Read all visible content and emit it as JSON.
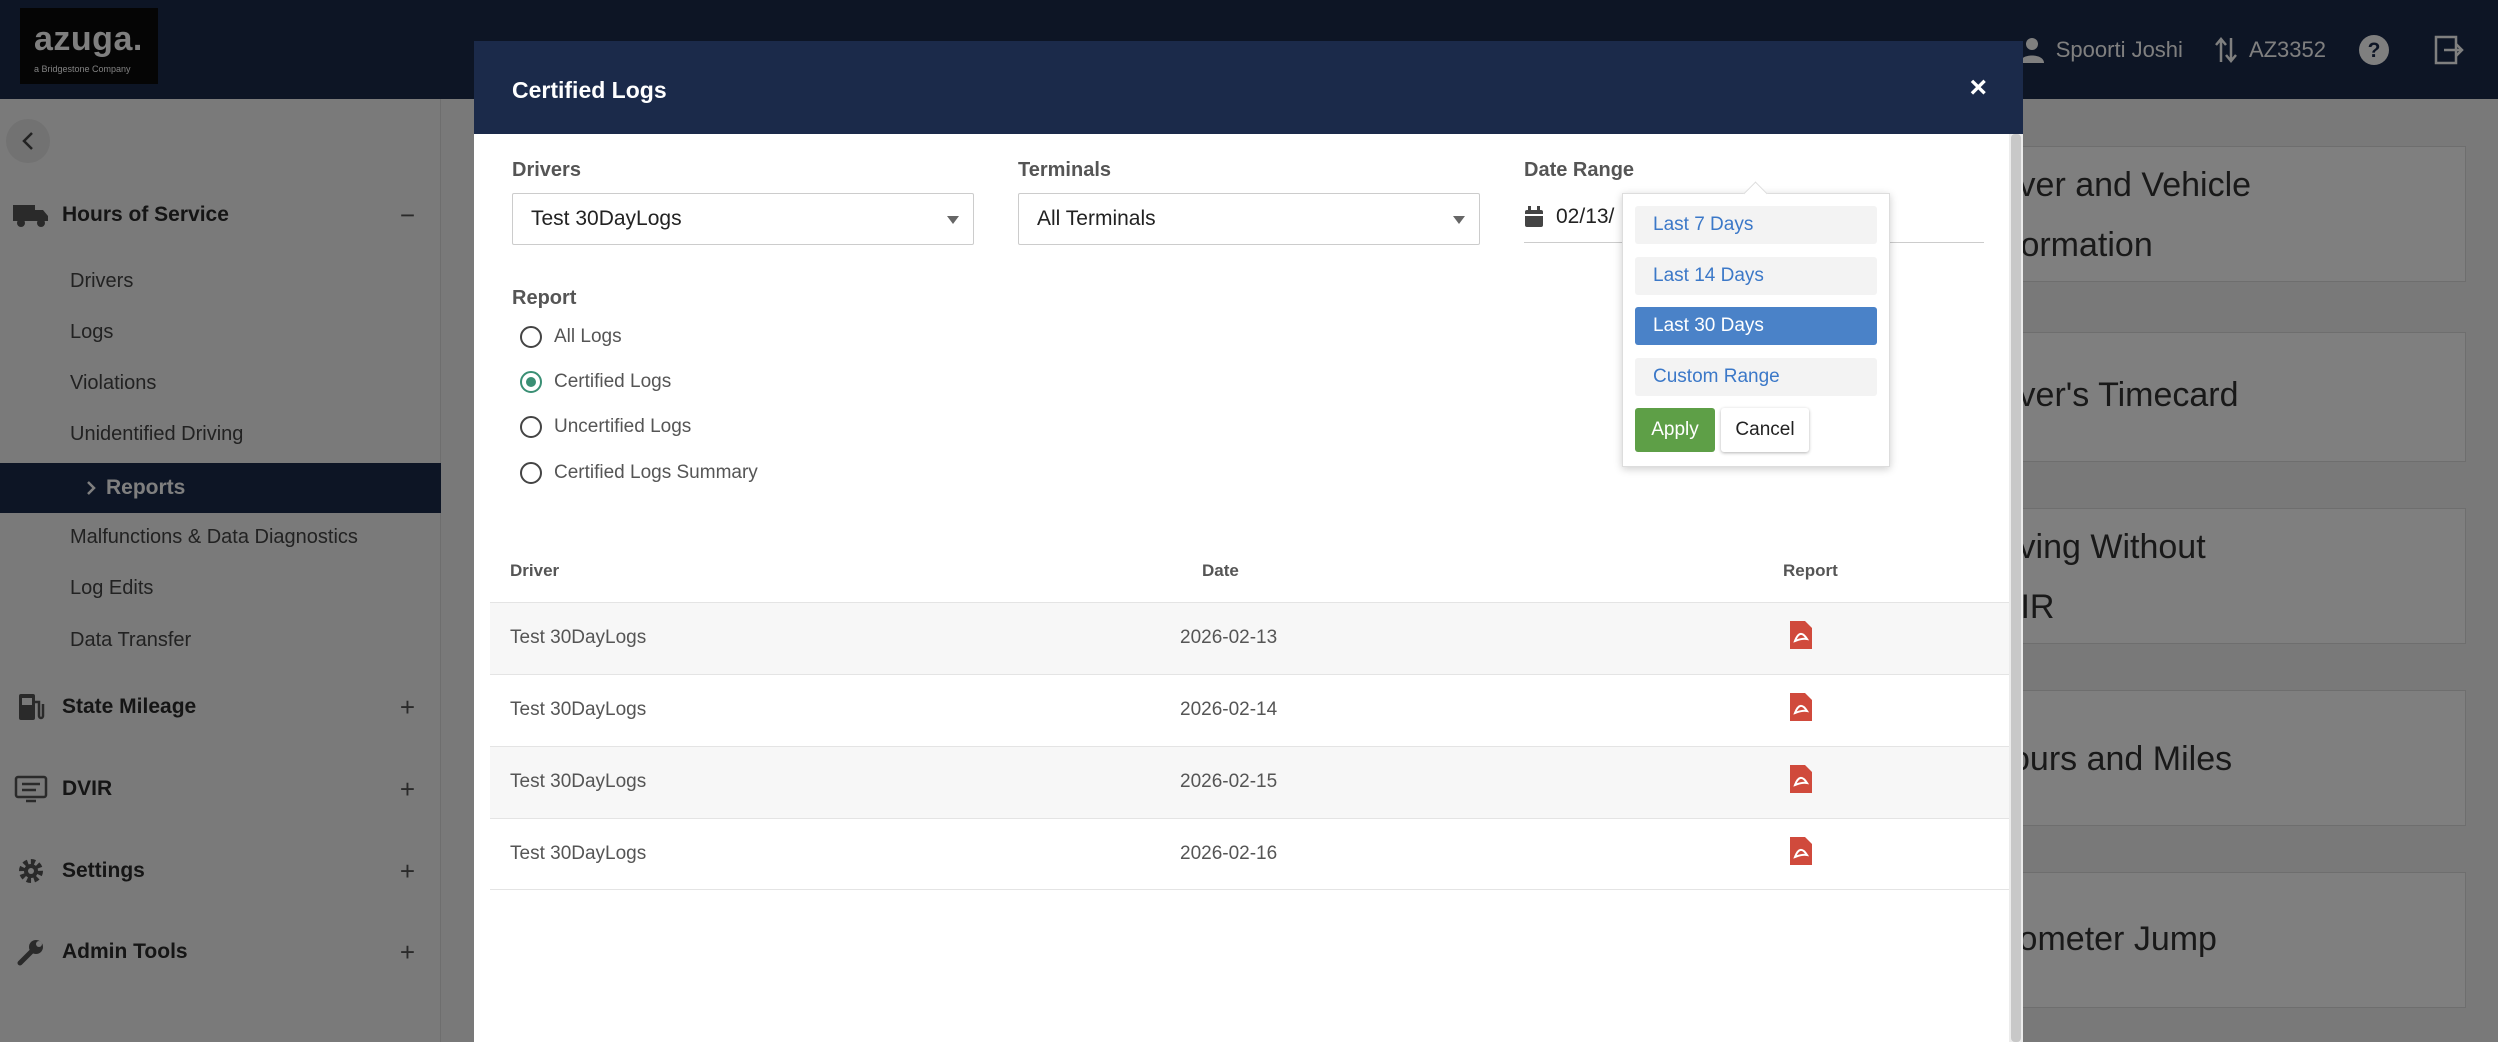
{
  "header": {
    "logo_text": "azuga.",
    "logo_tagline": "a Bridgestone Company",
    "user_name": "Spoorti Joshi",
    "account_id": "AZ3352"
  },
  "sidebar": {
    "sections": [
      {
        "label": "Hours of Service",
        "toggle": "−",
        "icon": "truck-icon"
      },
      {
        "label": "State Mileage",
        "toggle": "+",
        "icon": "fuel-pump-icon"
      },
      {
        "label": "DVIR",
        "toggle": "+",
        "icon": "monitor-icon"
      },
      {
        "label": "Settings",
        "toggle": "+",
        "icon": "gear-icon"
      },
      {
        "label": "Admin Tools",
        "toggle": "+",
        "icon": "wrench-icon"
      }
    ],
    "hos_items": [
      "Drivers",
      "Logs",
      "Violations",
      "Unidentified Driving",
      "Reports",
      "Malfunctions & Data Diagnostics",
      "Log Edits",
      "Data Transfer"
    ]
  },
  "background_cards": [
    "iver and Vehicle",
    "formation",
    "iver's Timecard",
    "iving Without",
    "/IR",
    "ours and Miles",
    "lometer Jump"
  ],
  "modal": {
    "title": "Certified Logs",
    "close_label": "×",
    "drivers_label": "Drivers",
    "drivers_value": "Test 30DayLogs",
    "terminals_label": "Terminals",
    "terminals_value": "All Terminals",
    "date_range_label": "Date Range",
    "date_range_value": "02/13/",
    "report_label": "Report",
    "report_options": [
      {
        "label": "All Logs",
        "selected": false
      },
      {
        "label": "Certified Logs",
        "selected": true
      },
      {
        "label": "Uncertified Logs",
        "selected": false
      },
      {
        "label": "Certified Logs Summary",
        "selected": false
      }
    ],
    "table": {
      "headers": [
        "Driver",
        "Date",
        "Report"
      ],
      "rows": [
        {
          "driver": "Test 30DayLogs",
          "date": "2026-02-13",
          "report_icon": "pdf-icon"
        },
        {
          "driver": "Test 30DayLogs",
          "date": "2026-02-14",
          "report_icon": "pdf-icon"
        },
        {
          "driver": "Test 30DayLogs",
          "date": "2026-02-15",
          "report_icon": "pdf-icon"
        },
        {
          "driver": "Test 30DayLogs",
          "date": "2026-02-16",
          "report_icon": "pdf-icon"
        }
      ]
    }
  },
  "date_range_dropdown": {
    "options": [
      {
        "label": "Last 7 Days",
        "active": false
      },
      {
        "label": "Last 14 Days",
        "active": false
      },
      {
        "label": "Last 30 Days",
        "active": true
      },
      {
        "label": "Custom Range",
        "active": false
      }
    ],
    "apply_label": "Apply",
    "cancel_label": "Cancel"
  },
  "colors": {
    "navy": "#1b2a4a",
    "apply_green": "#5e9f47",
    "range_active": "#4a82c8",
    "pdf_red": "#d04a3c",
    "radio_green": "#3a8f74"
  }
}
